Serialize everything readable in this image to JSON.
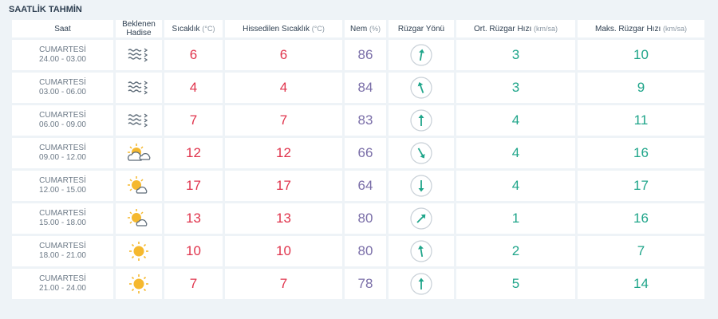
{
  "title": "SAATLİK TAHMİN",
  "columns": {
    "saat": "Saat",
    "hadise": "Beklenen Hadise",
    "sicaklik": "Sıcaklık",
    "sicaklik_unit": "(°C)",
    "hissedilen": "Hissedilen Sıcaklık",
    "hissedilen_unit": "(°C)",
    "nem": "Nem",
    "nem_unit": "(%)",
    "yon": "Rüzgar Yönü",
    "ort": "Ort. Rüzgar Hızı",
    "ort_unit": "(km/sa)",
    "maks": "Maks. Rüzgar Hızı",
    "maks_unit": "(km/sa)"
  },
  "colors": {
    "temperature": "#e0344c",
    "humidity": "#7a6ea8",
    "wind": "#1fa58a"
  },
  "rows": [
    {
      "day": "CUMARTESİ",
      "hours": "24.00 - 03.00",
      "icon": "fog-icon",
      "temp": "6",
      "feels": "6",
      "humidity": "86",
      "wind_dir_deg": 10,
      "avg": "3",
      "max": "10"
    },
    {
      "day": "CUMARTESİ",
      "hours": "03.00 - 06.00",
      "icon": "fog-icon",
      "temp": "4",
      "feels": "4",
      "humidity": "84",
      "wind_dir_deg": -20,
      "avg": "3",
      "max": "9"
    },
    {
      "day": "CUMARTESİ",
      "hours": "06.00 - 09.00",
      "icon": "fog-icon",
      "temp": "7",
      "feels": "7",
      "humidity": "83",
      "wind_dir_deg": 0,
      "avg": "4",
      "max": "11"
    },
    {
      "day": "CUMARTESİ",
      "hours": "09.00 - 12.00",
      "icon": "partly-cloudy-icon",
      "temp": "12",
      "feels": "12",
      "humidity": "66",
      "wind_dir_deg": 150,
      "avg": "4",
      "max": "16"
    },
    {
      "day": "CUMARTESİ",
      "hours": "12.00 - 15.00",
      "icon": "partly-sunny-icon",
      "temp": "17",
      "feels": "17",
      "humidity": "64",
      "wind_dir_deg": 180,
      "avg": "4",
      "max": "17"
    },
    {
      "day": "CUMARTESİ",
      "hours": "15.00 - 18.00",
      "icon": "partly-sunny-icon",
      "temp": "13",
      "feels": "13",
      "humidity": "80",
      "wind_dir_deg": 45,
      "avg": "1",
      "max": "16"
    },
    {
      "day": "CUMARTESİ",
      "hours": "18.00 - 21.00",
      "icon": "sun-icon",
      "temp": "10",
      "feels": "10",
      "humidity": "80",
      "wind_dir_deg": -10,
      "avg": "2",
      "max": "7"
    },
    {
      "day": "CUMARTESİ",
      "hours": "21.00 - 24.00",
      "icon": "sun-icon",
      "temp": "7",
      "feels": "7",
      "humidity": "78",
      "wind_dir_deg": 0,
      "avg": "5",
      "max": "14"
    }
  ]
}
